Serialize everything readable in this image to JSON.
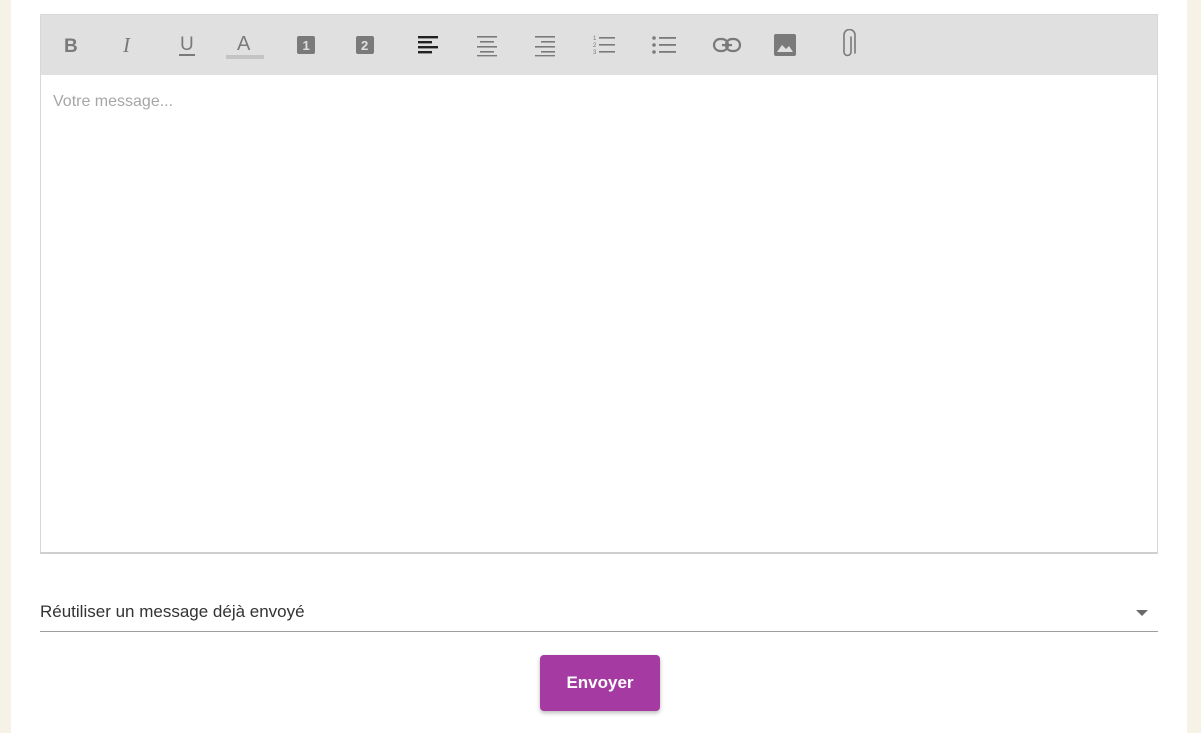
{
  "editor": {
    "placeholder": "Votre message...",
    "toolbar": [
      {
        "name": "bold-button",
        "icon": "bold-icon",
        "glyph": "B"
      },
      {
        "name": "italic-button",
        "icon": "italic-icon",
        "glyph": "I"
      },
      {
        "name": "underline-button",
        "icon": "underline-icon",
        "glyph": "U"
      },
      {
        "name": "text-color-button",
        "icon": "text-color-icon",
        "glyph": "A"
      },
      {
        "name": "heading-1-button",
        "icon": "heading-1-icon",
        "glyph": "1"
      },
      {
        "name": "heading-2-button",
        "icon": "heading-2-icon",
        "glyph": "2"
      },
      {
        "name": "align-left-button",
        "icon": "align-left-icon"
      },
      {
        "name": "align-center-button",
        "icon": "align-center-icon"
      },
      {
        "name": "align-right-button",
        "icon": "align-right-icon"
      },
      {
        "name": "ordered-list-button",
        "icon": "ordered-list-icon"
      },
      {
        "name": "bullet-list-button",
        "icon": "bullet-list-icon"
      },
      {
        "name": "link-button",
        "icon": "link-icon"
      },
      {
        "name": "image-button",
        "icon": "image-icon"
      },
      {
        "name": "attachment-button",
        "icon": "paperclip-icon"
      }
    ]
  },
  "reuse_select": {
    "label": "Réutiliser un message déjà envoyé",
    "icon": "caret-down-icon"
  },
  "send_button": {
    "label": "Envoyer"
  },
  "colors": {
    "accent": "#a43aa2",
    "toolbar_bg": "#e0e0e0",
    "icon_gray": "#7a7a7a",
    "icon_active": "#222222",
    "page_bg": "#f6f3e6"
  }
}
